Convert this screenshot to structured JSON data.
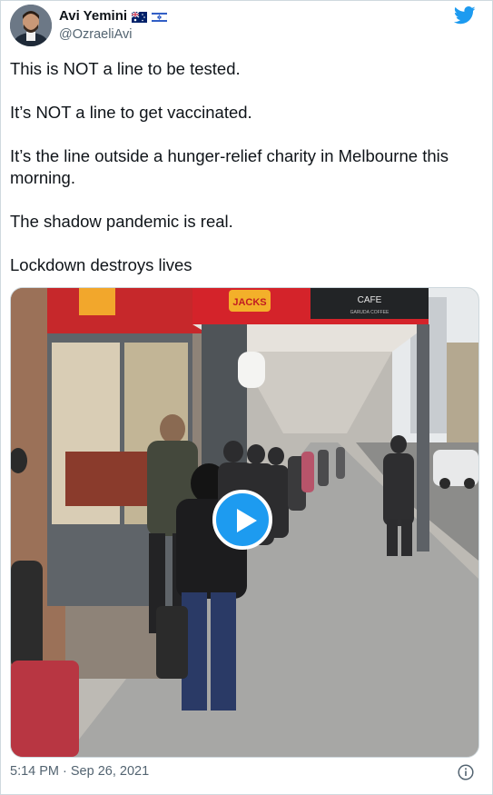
{
  "author": {
    "name": "Avi Yemini",
    "handle": "@OzraeliAvi",
    "flags": [
      "australia-flag",
      "israel-flag"
    ]
  },
  "tweet": {
    "paragraphs": [
      "This is NOT a line to be tested.",
      "It’s NOT a line to get vaccinated.",
      "It’s the line outside a hunger-relief charity in Melbourne this morning.",
      "The shadow pandemic is real.",
      "Lockdown destroys lives"
    ],
    "timestamp": "5:14 PM · Sep 26, 2021"
  },
  "media": {
    "type": "video",
    "signs": {
      "jacks": "JACKS",
      "cafe": "CAFE",
      "cafe_sub": "GARUDA COFFEE"
    }
  },
  "icons": [
    "twitter-bird-icon",
    "play-icon",
    "info-icon"
  ],
  "colors": {
    "brand": "#1d9bf0",
    "text": "#0f1419",
    "muted": "#536471",
    "border": "#cfd9de"
  }
}
